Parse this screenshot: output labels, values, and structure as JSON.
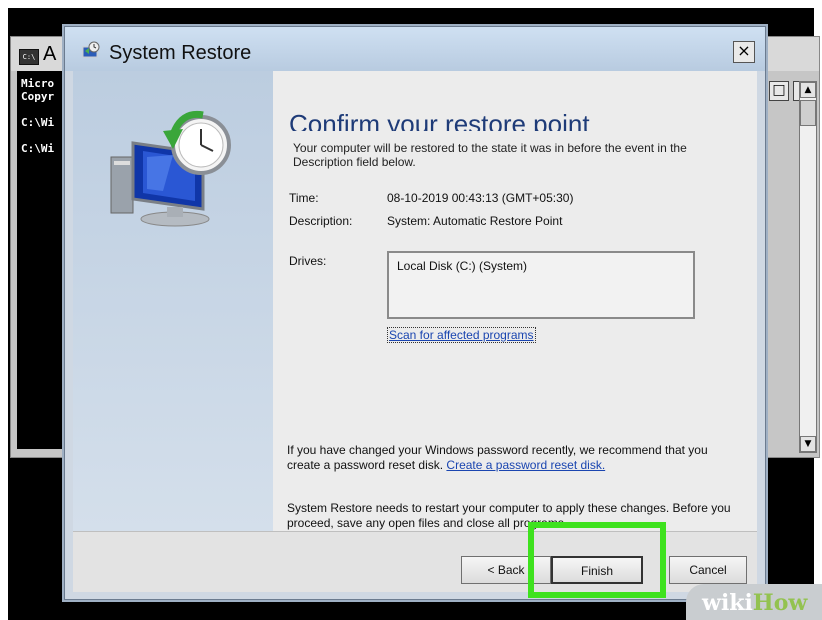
{
  "console": {
    "title": "A",
    "icon_label": "C:\\",
    "lines": [
      "Micro",
      "Copyr",
      "",
      "C:\\Wi",
      "",
      "C:\\Wi"
    ]
  },
  "dialog": {
    "title": "System Restore",
    "close_label": "×",
    "heading": "Confirm your restore point",
    "intro": "Your computer will be restored to the state it was in before the event in the Description field below.",
    "time_label": "Time:",
    "time_value": "08-10-2019 00:43:13 (GMT+05:30)",
    "description_label": "Description:",
    "description_value": "System: Automatic Restore Point",
    "drives_label": "Drives:",
    "drives_value": "Local Disk (C:) (System)",
    "scan_link": "Scan for affected programs",
    "password_note": "If you have changed your Windows password recently, we recommend that you create a password reset disk.",
    "password_link": "Create a password reset disk.",
    "restart_note": "System Restore needs to restart your computer to apply these changes. Before you proceed, save any open files and close all programs.",
    "buttons": {
      "back": "< Back",
      "finish": "Finish",
      "cancel": "Cancel"
    }
  },
  "watermark": {
    "part1": "wiki",
    "part2": "How"
  },
  "colors": {
    "highlight": "#3ee21e",
    "heading": "#1e3b78",
    "link": "#1a45b0"
  },
  "icons": [
    "console-icon",
    "system-restore-icon",
    "close-icon",
    "minimize-icon",
    "maximize-icon",
    "computer-clock-icon"
  ]
}
